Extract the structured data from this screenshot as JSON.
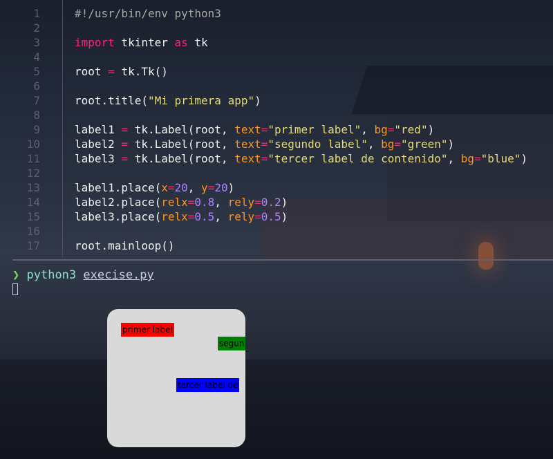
{
  "editor": {
    "lines": [
      {
        "n": "1",
        "tokens": [
          {
            "t": "#!/usr/bin/env python3",
            "k": "comment"
          }
        ]
      },
      {
        "n": "2",
        "tokens": []
      },
      {
        "n": "3",
        "tokens": [
          {
            "t": "import",
            "k": "kw"
          },
          {
            "t": " tkinter ",
            "k": "plain"
          },
          {
            "t": "as",
            "k": "kw"
          },
          {
            "t": " tk",
            "k": "plain"
          }
        ]
      },
      {
        "n": "4",
        "tokens": []
      },
      {
        "n": "5",
        "tokens": [
          {
            "t": "root ",
            "k": "plain"
          },
          {
            "t": "=",
            "k": "op"
          },
          {
            "t": " tk.Tk()",
            "k": "plain"
          }
        ]
      },
      {
        "n": "6",
        "tokens": []
      },
      {
        "n": "7",
        "tokens": [
          {
            "t": "root.title(",
            "k": "plain"
          },
          {
            "t": "\"Mi primera app\"",
            "k": "str"
          },
          {
            "t": ")",
            "k": "plain"
          }
        ]
      },
      {
        "n": "8",
        "tokens": []
      },
      {
        "n": "9",
        "tokens": [
          {
            "t": "label1 ",
            "k": "plain"
          },
          {
            "t": "=",
            "k": "op"
          },
          {
            "t": " tk.Label(root, ",
            "k": "plain"
          },
          {
            "t": "text",
            "k": "param"
          },
          {
            "t": "=",
            "k": "op"
          },
          {
            "t": "\"primer label\"",
            "k": "str"
          },
          {
            "t": ", ",
            "k": "plain"
          },
          {
            "t": "bg",
            "k": "param"
          },
          {
            "t": "=",
            "k": "op"
          },
          {
            "t": "\"red\"",
            "k": "str"
          },
          {
            "t": ")",
            "k": "plain"
          }
        ]
      },
      {
        "n": "10",
        "tokens": [
          {
            "t": "label2 ",
            "k": "plain"
          },
          {
            "t": "=",
            "k": "op"
          },
          {
            "t": " tk.Label(root, ",
            "k": "plain"
          },
          {
            "t": "text",
            "k": "param"
          },
          {
            "t": "=",
            "k": "op"
          },
          {
            "t": "\"segundo label\"",
            "k": "str"
          },
          {
            "t": ", ",
            "k": "plain"
          },
          {
            "t": "bg",
            "k": "param"
          },
          {
            "t": "=",
            "k": "op"
          },
          {
            "t": "\"green\"",
            "k": "str"
          },
          {
            "t": ")",
            "k": "plain"
          }
        ]
      },
      {
        "n": "11",
        "tokens": [
          {
            "t": "label3 ",
            "k": "plain"
          },
          {
            "t": "=",
            "k": "op"
          },
          {
            "t": " tk.Label(root, ",
            "k": "plain"
          },
          {
            "t": "text",
            "k": "param"
          },
          {
            "t": "=",
            "k": "op"
          },
          {
            "t": "\"tercer label de contenido\"",
            "k": "str"
          },
          {
            "t": ", ",
            "k": "plain"
          },
          {
            "t": "bg",
            "k": "param"
          },
          {
            "t": "=",
            "k": "op"
          },
          {
            "t": "\"blue\"",
            "k": "str"
          },
          {
            "t": ")",
            "k": "plain"
          }
        ]
      },
      {
        "n": "12",
        "tokens": []
      },
      {
        "n": "13",
        "tokens": [
          {
            "t": "label1.place(",
            "k": "plain"
          },
          {
            "t": "x",
            "k": "param"
          },
          {
            "t": "=",
            "k": "op"
          },
          {
            "t": "20",
            "k": "num"
          },
          {
            "t": ", ",
            "k": "plain"
          },
          {
            "t": "y",
            "k": "param"
          },
          {
            "t": "=",
            "k": "op"
          },
          {
            "t": "20",
            "k": "num"
          },
          {
            "t": ")",
            "k": "plain"
          }
        ]
      },
      {
        "n": "14",
        "tokens": [
          {
            "t": "label2.place(",
            "k": "plain"
          },
          {
            "t": "relx",
            "k": "param"
          },
          {
            "t": "=",
            "k": "op"
          },
          {
            "t": "0.8",
            "k": "num"
          },
          {
            "t": ", ",
            "k": "plain"
          },
          {
            "t": "rely",
            "k": "param"
          },
          {
            "t": "=",
            "k": "op"
          },
          {
            "t": "0.2",
            "k": "num"
          },
          {
            "t": ")",
            "k": "plain"
          }
        ]
      },
      {
        "n": "15",
        "tokens": [
          {
            "t": "label3.place(",
            "k": "plain"
          },
          {
            "t": "relx",
            "k": "param"
          },
          {
            "t": "=",
            "k": "op"
          },
          {
            "t": "0.5",
            "k": "num"
          },
          {
            "t": ", ",
            "k": "plain"
          },
          {
            "t": "rely",
            "k": "param"
          },
          {
            "t": "=",
            "k": "op"
          },
          {
            "t": "0.5",
            "k": "num"
          },
          {
            "t": ")",
            "k": "plain"
          }
        ]
      },
      {
        "n": "16",
        "tokens": []
      },
      {
        "n": "17",
        "tokens": [
          {
            "t": "root.mainloop()",
            "k": "plain"
          }
        ]
      }
    ]
  },
  "terminal": {
    "prompt_symbol": "❯",
    "command": "python3",
    "argument": "execise.py"
  },
  "tk_window": {
    "labels": [
      {
        "text": "primer label",
        "bg": "#ff0000"
      },
      {
        "text": "segun",
        "bg": "#008000"
      },
      {
        "text": "tercer label de",
        "bg": "#0000ff"
      }
    ]
  },
  "colors": {
    "keyword": "#f92672",
    "string": "#e6db74",
    "param": "#fd971f",
    "number": "#ae81ff",
    "comment": "#a9a9a9",
    "prompt_arrow": "#7fd962",
    "command": "#8be0c6"
  }
}
